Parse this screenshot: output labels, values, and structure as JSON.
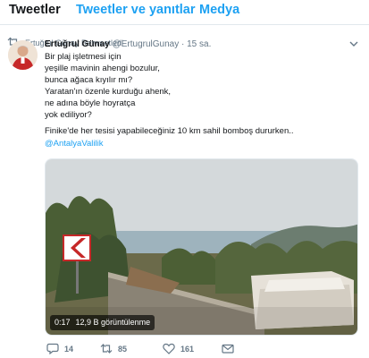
{
  "tabs": [
    {
      "label": "Tweetler"
    },
    {
      "label": "Tweetler ve yanıtlar"
    },
    {
      "label": "Medya"
    }
  ],
  "tweet": {
    "retweet_context": "Ertuğrul Günay Retweetledi",
    "author_name": "Ertuğrul Günay",
    "handle": "@ErtugrulGunay",
    "separator": "·",
    "time": "15 sa.",
    "lines": [
      "Bir plaj işletmesi için",
      "yeşille mavinin ahengi bozulur,",
      "bunca ağaca kıyılır mı?",
      "Yaratan'ın özenle kurduğu ahenk,",
      "ne adına böyle hoyratça",
      "yok ediliyor?",
      "Finike'de her tesisi yapabileceğiniz 10 km sahil bomboş dururken.."
    ],
    "mention": "@AntalyaValilik",
    "video": {
      "duration": "0:17",
      "views": "12,9 B görüntülenme"
    },
    "actions": {
      "replies": "14",
      "retweets": "85",
      "likes": "161"
    }
  },
  "colors": {
    "accent": "#1da1f2",
    "text": "#14171a",
    "muted": "#657786",
    "border": "#e1e8ed"
  }
}
